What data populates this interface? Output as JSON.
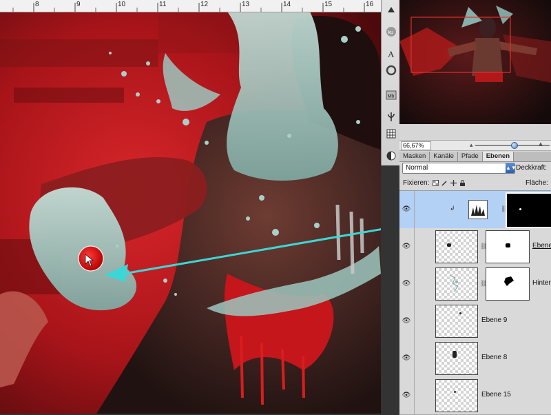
{
  "ruler": {
    "ticks": [
      "8",
      "9",
      "10",
      "11",
      "12",
      "13",
      "14",
      "15",
      "16"
    ]
  },
  "navigator": {
    "zoom_value": "66,67%"
  },
  "layers_panel": {
    "tabs": [
      {
        "label": "Masken",
        "active": false
      },
      {
        "label": "Kanäle",
        "active": false
      },
      {
        "label": "Pfade",
        "active": false
      },
      {
        "label": "Ebenen",
        "active": true
      }
    ],
    "blend_mode": "Normal",
    "opacity_label": "Deckkraft:",
    "lock_label": "Fixieren:",
    "fill_label": "Fläche:",
    "layers": [
      {
        "name": "",
        "selected": true,
        "visible": true
      },
      {
        "name": "Ebene",
        "selected": false,
        "visible": true
      },
      {
        "name": "Hinter",
        "selected": false,
        "visible": true
      },
      {
        "name": "Ebene 9",
        "selected": false,
        "visible": true
      },
      {
        "name": "Ebene 8",
        "selected": false,
        "visible": true
      },
      {
        "name": "Ebene 15",
        "selected": false,
        "visible": true
      }
    ]
  },
  "colors": {
    "arrow": "#3cd6d6",
    "selection_highlight": "#b3d0f5",
    "canvas_red": "#c81e1e",
    "splash": "#9cc7be"
  },
  "icons": {
    "tools": [
      "arrow-up-icon",
      "ku-icon",
      "character-icon",
      "ring-icon",
      "mb-icon",
      "usb-icon",
      "grid-icon",
      "circle-half-icon"
    ],
    "lock": [
      "lock-transparency-icon",
      "lock-brush-icon",
      "lock-move-icon",
      "lock-all-icon"
    ]
  }
}
